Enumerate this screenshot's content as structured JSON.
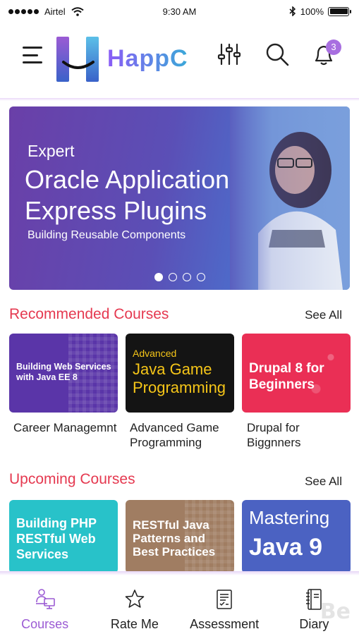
{
  "status_bar": {
    "carrier": "Airtel",
    "time": "9:30 AM",
    "battery": "100%",
    "battery_level": 1.0
  },
  "header": {
    "brand": "HappC",
    "notification_count": "3",
    "icons": [
      "menu-icon",
      "logo",
      "filter-sliders-icon",
      "search-icon",
      "bell-icon"
    ]
  },
  "hero": {
    "level": "Expert",
    "title": "Oracle Application Express Plugins",
    "subtitle": "Building Reusable Components",
    "slide_count": 4,
    "active_slide": 1,
    "colors": [
      "#6a3fa8",
      "#5686d6"
    ]
  },
  "recommended": {
    "title": "Recommended Courses",
    "see_all": "See All",
    "courses": [
      {
        "thumb_text": "Building Web Services with Java EE 8",
        "caption": "Career Managemnt",
        "color": "#5a35a8"
      },
      {
        "thumb_text_small": "Advanced",
        "thumb_text": "Java Game Programming",
        "caption": "Advanced Game Programming",
        "color": "#141414",
        "text_color": "#f5c518"
      },
      {
        "thumb_text": "Drupal 8 for Beginners",
        "caption": "Drupal for Biggnners",
        "color": "#ea2f55"
      }
    ]
  },
  "upcoming": {
    "title": "Upcoming Courses",
    "see_all": "See All",
    "courses": [
      {
        "thumb_text": "Building PHP RESTful Web Services",
        "color": "#28c2c9"
      },
      {
        "thumb_text": "RESTful Java Patterns and Best Practices",
        "color": "#a07d62"
      },
      {
        "thumb_text_small": "Mastering",
        "thumb_text": "Java 9",
        "color": "#4b62c2"
      }
    ]
  },
  "bottom_nav": {
    "items": [
      {
        "label": "Courses",
        "icon": "courses-icon",
        "active": true
      },
      {
        "label": "Rate Me",
        "icon": "star-icon",
        "active": false
      },
      {
        "label": "Assessment",
        "icon": "assessment-doc-icon",
        "active": false
      },
      {
        "label": "Diary",
        "icon": "diary-notebook-icon",
        "active": false
      }
    ],
    "accent_color": "#9b5bd4"
  },
  "watermark": "Be"
}
